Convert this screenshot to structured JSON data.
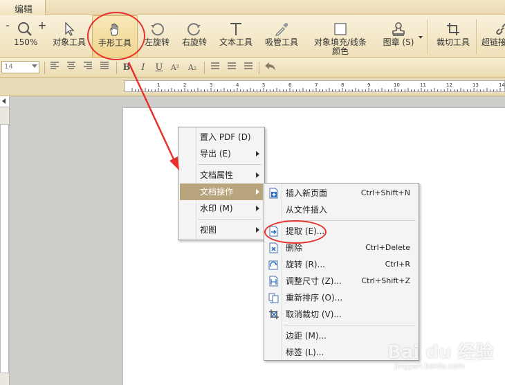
{
  "tab": {
    "label": "编辑"
  },
  "zoom": {
    "minus": "-",
    "plus": "+",
    "value": "150%"
  },
  "ribbon": {
    "object_tool": "对象工具",
    "hand_tool": "手形工具",
    "rotate_left": "左旋转",
    "rotate_right": "右旋转",
    "text_tool": "文本工具",
    "eyedropper": "吸管工具",
    "fill_color": "对象填充/线条颜色",
    "stamp": "图章 (S)",
    "crop_tool": "裁切工具",
    "link_tool": "超链接"
  },
  "format": {
    "font_size": "14",
    "bold": "B",
    "italic": "I",
    "underline": "U",
    "superscript": "A²",
    "subscript": "A₂"
  },
  "ruler": {
    "ticks": [
      "1",
      "2",
      "3",
      "4",
      "5",
      "6",
      "7",
      "8",
      "9",
      "10",
      "11",
      "12",
      "13",
      "14"
    ]
  },
  "context_menu": {
    "items": [
      {
        "label": "置入 PDF (D)"
      },
      {
        "label": "导出 (E)"
      },
      {
        "label": "文档属性"
      },
      {
        "label": "文档操作"
      },
      {
        "label": "水印 (M)"
      },
      {
        "label": "视图"
      }
    ]
  },
  "submenu": {
    "items": [
      {
        "label": "插入新页面",
        "shortcut": "Ctrl+Shift+N",
        "icon": "insert-page-icon"
      },
      {
        "label": "从文件插入",
        "shortcut": ""
      },
      {
        "label": "提取 (E)...",
        "shortcut": "",
        "icon": "extract-page-icon"
      },
      {
        "label": "删除",
        "shortcut": "Ctrl+Delete",
        "icon": "delete-page-icon"
      },
      {
        "label": "旋转 (R)...",
        "shortcut": "Ctrl+R",
        "icon": "rotate-page-icon"
      },
      {
        "label": "调整尺寸 (Z)...",
        "shortcut": "Ctrl+Shift+Z",
        "icon": "resize-page-icon"
      },
      {
        "label": "重新排序 (O)...",
        "shortcut": "",
        "icon": "reorder-pages-icon"
      },
      {
        "label": "取消裁切 (V)...",
        "shortcut": "",
        "icon": "uncrop-icon"
      },
      {
        "label": "边距 (M)...",
        "shortcut": ""
      },
      {
        "label": "标签 (L)...",
        "shortcut": ""
      }
    ]
  },
  "watermark": {
    "brand": "Bai du 经验",
    "url": "jingyan.baidu.com"
  },
  "colors": {
    "annotation": "#e8302c",
    "menu_highlight": "#b9a57d"
  }
}
